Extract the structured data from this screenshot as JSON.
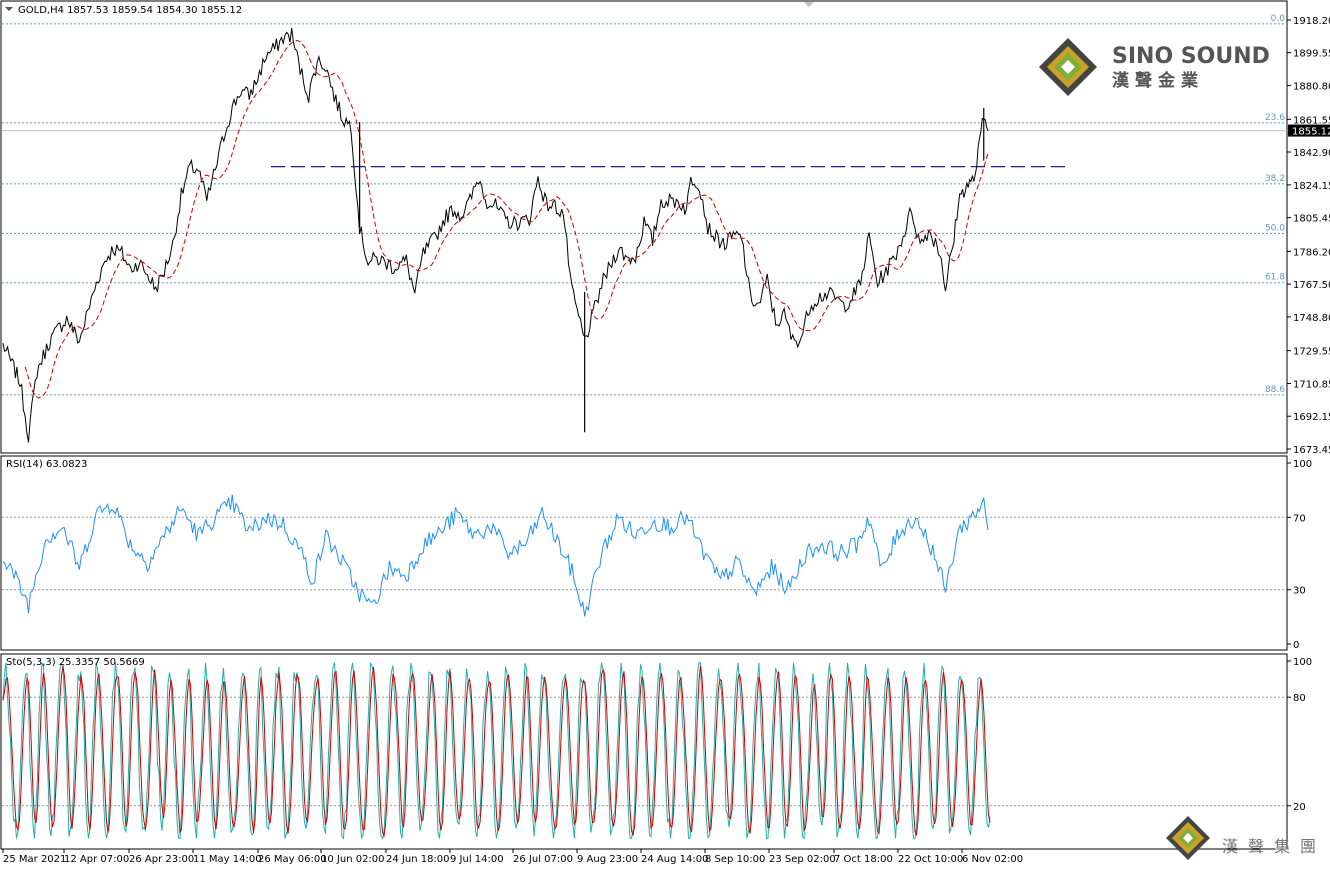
{
  "main_header": "GOLD,H4  1857.53 1859.54 1854.30 1855.12",
  "rsi_header": "RSI(14) 63.0823",
  "sto_header": "Sto(5,3,3) 25.3357 50.5669",
  "current_price": "1855.12",
  "brand": {
    "name_en": "SINO SOUND",
    "name_zh": "漢聲金業",
    "footer_zh": "漢聲集團",
    "colors": {
      "gold": "#c9a227",
      "green": "#7fae3a",
      "dark": "#444444"
    }
  },
  "colors": {
    "price": "#000000",
    "ma": "#cc0000",
    "resistance": "#000080",
    "rsi": "#1e90ff",
    "sto_main": "#20b2aa",
    "sto_signal": "#cc0000",
    "fib": "#6699bb",
    "frame": "#000000"
  },
  "chart_data": [
    {
      "type": "line",
      "title": "GOLD,H4",
      "ylim": [
        1673.45,
        1918.2
      ],
      "y_ticks": [
        "1918.20",
        "1899.55",
        "1880.80",
        "1861.55",
        "1842.90",
        "1824.15",
        "1805.45",
        "1786.20",
        "1767.50",
        "1748.80",
        "1729.55",
        "1710.85",
        "1692.15",
        "1673.45"
      ],
      "x_ticks": [
        "25 Mar 2021",
        "12 Apr 07:00",
        "26 Apr 23:00",
        "11 May 14:00",
        "26 May 06:00",
        "10 Jun 02:00",
        "24 Jun 18:00",
        "9 Jul 14:00",
        "26 Jul 07:00",
        "9 Aug 23:00",
        "24 Aug 14:00",
        "8 Sep 10:00",
        "23 Sep 02:00",
        "7 Oct 18:00",
        "22 Oct 10:00",
        "6 Nov 02:00"
      ],
      "fib_levels": [
        {
          "label": "0.0",
          "value": 1916.0
        },
        {
          "label": "23.6",
          "value": 1859.5
        },
        {
          "label": "38.2",
          "value": 1824.7
        },
        {
          "label": "50.0",
          "value": 1796.5
        },
        {
          "label": "61.8",
          "value": 1768.3
        },
        {
          "label": "88.6",
          "value": 1704.3
        }
      ],
      "resistance": {
        "value": 1834.5,
        "start": "26 May 2021",
        "end": "12 Nov 2021"
      },
      "close": [
        {
          "x": "2021-03-25",
          "y": 1733
        },
        {
          "x": "2021-03-29",
          "y": 1712
        },
        {
          "x": "2021-03-31",
          "y": 1681
        },
        {
          "x": "2021-04-02",
          "y": 1718
        },
        {
          "x": "2021-04-05",
          "y": 1735
        },
        {
          "x": "2021-04-07",
          "y": 1742
        },
        {
          "x": "2021-04-09",
          "y": 1748
        },
        {
          "x": "2021-04-12",
          "y": 1735
        },
        {
          "x": "2021-04-14",
          "y": 1752
        },
        {
          "x": "2021-04-16",
          "y": 1768
        },
        {
          "x": "2021-04-18",
          "y": 1781
        },
        {
          "x": "2021-04-20",
          "y": 1788
        },
        {
          "x": "2021-04-22",
          "y": 1785
        },
        {
          "x": "2021-04-24",
          "y": 1776
        },
        {
          "x": "2021-04-26",
          "y": 1780
        },
        {
          "x": "2021-04-28",
          "y": 1773
        },
        {
          "x": "2021-04-30",
          "y": 1765
        },
        {
          "x": "2021-05-02",
          "y": 1775
        },
        {
          "x": "2021-05-04",
          "y": 1790
        },
        {
          "x": "2021-05-06",
          "y": 1818
        },
        {
          "x": "2021-05-08",
          "y": 1834
        },
        {
          "x": "2021-05-10",
          "y": 1833
        },
        {
          "x": "2021-05-12",
          "y": 1815
        },
        {
          "x": "2021-05-14",
          "y": 1833
        },
        {
          "x": "2021-05-16",
          "y": 1852
        },
        {
          "x": "2021-05-18",
          "y": 1868
        },
        {
          "x": "2021-05-20",
          "y": 1878
        },
        {
          "x": "2021-05-22",
          "y": 1875
        },
        {
          "x": "2021-05-24",
          "y": 1885
        },
        {
          "x": "2021-05-26",
          "y": 1898
        },
        {
          "x": "2021-05-28",
          "y": 1902
        },
        {
          "x": "2021-05-30",
          "y": 1908
        },
        {
          "x": "2021-06-01",
          "y": 1910
        },
        {
          "x": "2021-06-03",
          "y": 1890
        },
        {
          "x": "2021-06-05",
          "y": 1875
        },
        {
          "x": "2021-06-07",
          "y": 1895
        },
        {
          "x": "2021-06-09",
          "y": 1892
        },
        {
          "x": "2021-06-11",
          "y": 1875
        },
        {
          "x": "2021-06-13",
          "y": 1862
        },
        {
          "x": "2021-06-15",
          "y": 1858
        },
        {
          "x": "2021-06-17",
          "y": 1800
        },
        {
          "x": "2021-06-19",
          "y": 1780
        },
        {
          "x": "2021-06-21",
          "y": 1782
        },
        {
          "x": "2021-06-23",
          "y": 1780
        },
        {
          "x": "2021-06-25",
          "y": 1777
        },
        {
          "x": "2021-06-28",
          "y": 1781
        },
        {
          "x": "2021-06-30",
          "y": 1762
        },
        {
          "x": "2021-07-02",
          "y": 1785
        },
        {
          "x": "2021-07-05",
          "y": 1795
        },
        {
          "x": "2021-07-07",
          "y": 1805
        },
        {
          "x": "2021-07-09",
          "y": 1810
        },
        {
          "x": "2021-07-11",
          "y": 1807
        },
        {
          "x": "2021-07-13",
          "y": 1815
        },
        {
          "x": "2021-07-15",
          "y": 1828
        },
        {
          "x": "2021-07-17",
          "y": 1815
        },
        {
          "x": "2021-07-19",
          "y": 1812
        },
        {
          "x": "2021-07-21",
          "y": 1805
        },
        {
          "x": "2021-07-23",
          "y": 1802
        },
        {
          "x": "2021-07-25",
          "y": 1803
        },
        {
          "x": "2021-07-27",
          "y": 1805
        },
        {
          "x": "2021-07-29",
          "y": 1828
        },
        {
          "x": "2021-07-31",
          "y": 1813
        },
        {
          "x": "2021-08-02",
          "y": 1812
        },
        {
          "x": "2021-08-04",
          "y": 1808
        },
        {
          "x": "2021-08-06",
          "y": 1763
        },
        {
          "x": "2021-08-08",
          "y": 1745
        },
        {
          "x": "2021-08-09",
          "y": 1735
        },
        {
          "x": "2021-08-11",
          "y": 1750
        },
        {
          "x": "2021-08-13",
          "y": 1767
        },
        {
          "x": "2021-08-15",
          "y": 1778
        },
        {
          "x": "2021-08-17",
          "y": 1788
        },
        {
          "x": "2021-08-19",
          "y": 1782
        },
        {
          "x": "2021-08-21",
          "y": 1783
        },
        {
          "x": "2021-08-23",
          "y": 1803
        },
        {
          "x": "2021-08-25",
          "y": 1792
        },
        {
          "x": "2021-08-27",
          "y": 1815
        },
        {
          "x": "2021-08-29",
          "y": 1815
        },
        {
          "x": "2021-08-31",
          "y": 1815
        },
        {
          "x": "2021-09-02",
          "y": 1810
        },
        {
          "x": "2021-09-03",
          "y": 1828
        },
        {
          "x": "2021-09-05",
          "y": 1825
        },
        {
          "x": "2021-09-07",
          "y": 1800
        },
        {
          "x": "2021-09-09",
          "y": 1794
        },
        {
          "x": "2021-09-11",
          "y": 1790
        },
        {
          "x": "2021-09-13",
          "y": 1795
        },
        {
          "x": "2021-09-15",
          "y": 1794
        },
        {
          "x": "2021-09-17",
          "y": 1760
        },
        {
          "x": "2021-09-19",
          "y": 1755
        },
        {
          "x": "2021-09-21",
          "y": 1770
        },
        {
          "x": "2021-09-23",
          "y": 1745
        },
        {
          "x": "2021-09-25",
          "y": 1750
        },
        {
          "x": "2021-09-27",
          "y": 1735
        },
        {
          "x": "2021-09-29",
          "y": 1737
        },
        {
          "x": "2021-10-01",
          "y": 1755
        },
        {
          "x": "2021-10-03",
          "y": 1760
        },
        {
          "x": "2021-10-05",
          "y": 1762
        },
        {
          "x": "2021-10-07",
          "y": 1760
        },
        {
          "x": "2021-10-09",
          "y": 1755
        },
        {
          "x": "2021-10-11",
          "y": 1760
        },
        {
          "x": "2021-10-13",
          "y": 1768
        },
        {
          "x": "2021-10-15",
          "y": 1795
        },
        {
          "x": "2021-10-17",
          "y": 1768
        },
        {
          "x": "2021-10-19",
          "y": 1775
        },
        {
          "x": "2021-10-21",
          "y": 1783
        },
        {
          "x": "2021-10-23",
          "y": 1795
        },
        {
          "x": "2021-10-25",
          "y": 1810
        },
        {
          "x": "2021-10-27",
          "y": 1790
        },
        {
          "x": "2021-10-29",
          "y": 1798
        },
        {
          "x": "2021-10-31",
          "y": 1790
        },
        {
          "x": "2021-11-01",
          "y": 1782
        },
        {
          "x": "2021-11-02",
          "y": 1765
        },
        {
          "x": "2021-11-03",
          "y": 1780
        },
        {
          "x": "2021-11-04",
          "y": 1793
        },
        {
          "x": "2021-11-05",
          "y": 1815
        },
        {
          "x": "2021-11-06",
          "y": 1820
        },
        {
          "x": "2021-11-07",
          "y": 1824
        },
        {
          "x": "2021-11-08",
          "y": 1825
        },
        {
          "x": "2021-11-09",
          "y": 1830
        },
        {
          "x": "2021-11-10",
          "y": 1848
        },
        {
          "x": "2021-11-11",
          "y": 1863
        },
        {
          "x": "2021-11-12",
          "y": 1855
        }
      ],
      "spikes": [
        {
          "x": "2021-06-17",
          "low": 1800,
          "high": 1860
        },
        {
          "x": "2021-08-09",
          "low": 1683,
          "high": 1763
        },
        {
          "x": "2021-11-11",
          "low": 1838,
          "high": 1868
        }
      ]
    },
    {
      "type": "line",
      "title": "RSI(14) 63.0823",
      "ylim": [
        0,
        100
      ],
      "y_ticks": [
        100,
        70,
        30,
        0
      ],
      "levels": [
        70,
        30
      ],
      "values": [
        {
          "x": "2021-03-25",
          "y": 50
        },
        {
          "x": "2021-03-31",
          "y": 22
        },
        {
          "x": "2021-04-04",
          "y": 58
        },
        {
          "x": "2021-04-08",
          "y": 65
        },
        {
          "x": "2021-04-12",
          "y": 42
        },
        {
          "x": "2021-04-16",
          "y": 72
        },
        {
          "x": "2021-04-20",
          "y": 78
        },
        {
          "x": "2021-04-24",
          "y": 55
        },
        {
          "x": "2021-04-28",
          "y": 45
        },
        {
          "x": "2021-05-02",
          "y": 60
        },
        {
          "x": "2021-05-06",
          "y": 75
        },
        {
          "x": "2021-05-10",
          "y": 60
        },
        {
          "x": "2021-05-14",
          "y": 70
        },
        {
          "x": "2021-05-18",
          "y": 78
        },
        {
          "x": "2021-05-22",
          "y": 62
        },
        {
          "x": "2021-05-26",
          "y": 70
        },
        {
          "x": "2021-05-30",
          "y": 66
        },
        {
          "x": "2021-06-03",
          "y": 52
        },
        {
          "x": "2021-06-06",
          "y": 35
        },
        {
          "x": "2021-06-09",
          "y": 60
        },
        {
          "x": "2021-06-13",
          "y": 45
        },
        {
          "x": "2021-06-17",
          "y": 28
        },
        {
          "x": "2021-06-20",
          "y": 20
        },
        {
          "x": "2021-06-24",
          "y": 42
        },
        {
          "x": "2021-06-28",
          "y": 38
        },
        {
          "x": "2021-07-02",
          "y": 55
        },
        {
          "x": "2021-07-06",
          "y": 62
        },
        {
          "x": "2021-07-10",
          "y": 72
        },
        {
          "x": "2021-07-14",
          "y": 60
        },
        {
          "x": "2021-07-18",
          "y": 65
        },
        {
          "x": "2021-07-22",
          "y": 50
        },
        {
          "x": "2021-07-26",
          "y": 55
        },
        {
          "x": "2021-07-30",
          "y": 72
        },
        {
          "x": "2021-08-03",
          "y": 55
        },
        {
          "x": "2021-08-06",
          "y": 40
        },
        {
          "x": "2021-08-09",
          "y": 16
        },
        {
          "x": "2021-08-13",
          "y": 50
        },
        {
          "x": "2021-08-17",
          "y": 70
        },
        {
          "x": "2021-08-21",
          "y": 60
        },
        {
          "x": "2021-08-25",
          "y": 68
        },
        {
          "x": "2021-08-29",
          "y": 65
        },
        {
          "x": "2021-09-02",
          "y": 70
        },
        {
          "x": "2021-09-06",
          "y": 50
        },
        {
          "x": "2021-09-10",
          "y": 35
        },
        {
          "x": "2021-09-14",
          "y": 45
        },
        {
          "x": "2021-09-18",
          "y": 28
        },
        {
          "x": "2021-09-22",
          "y": 42
        },
        {
          "x": "2021-09-26",
          "y": 30
        },
        {
          "x": "2021-09-30",
          "y": 50
        },
        {
          "x": "2021-10-04",
          "y": 55
        },
        {
          "x": "2021-10-08",
          "y": 50
        },
        {
          "x": "2021-10-12",
          "y": 55
        },
        {
          "x": "2021-10-15",
          "y": 70
        },
        {
          "x": "2021-10-18",
          "y": 40
        },
        {
          "x": "2021-10-22",
          "y": 62
        },
        {
          "x": "2021-10-26",
          "y": 70
        },
        {
          "x": "2021-10-30",
          "y": 52
        },
        {
          "x": "2021-11-02",
          "y": 30
        },
        {
          "x": "2021-11-05",
          "y": 62
        },
        {
          "x": "2021-11-08",
          "y": 70
        },
        {
          "x": "2021-11-10",
          "y": 75
        },
        {
          "x": "2021-11-11",
          "y": 82
        },
        {
          "x": "2021-11-12",
          "y": 63
        }
      ]
    },
    {
      "type": "line",
      "title": "Sto(5,3,3) 25.3357 50.5669",
      "ylim": [
        0,
        100
      ],
      "y_ticks": [
        100,
        80,
        20
      ],
      "levels": [
        80,
        20
      ]
    }
  ]
}
